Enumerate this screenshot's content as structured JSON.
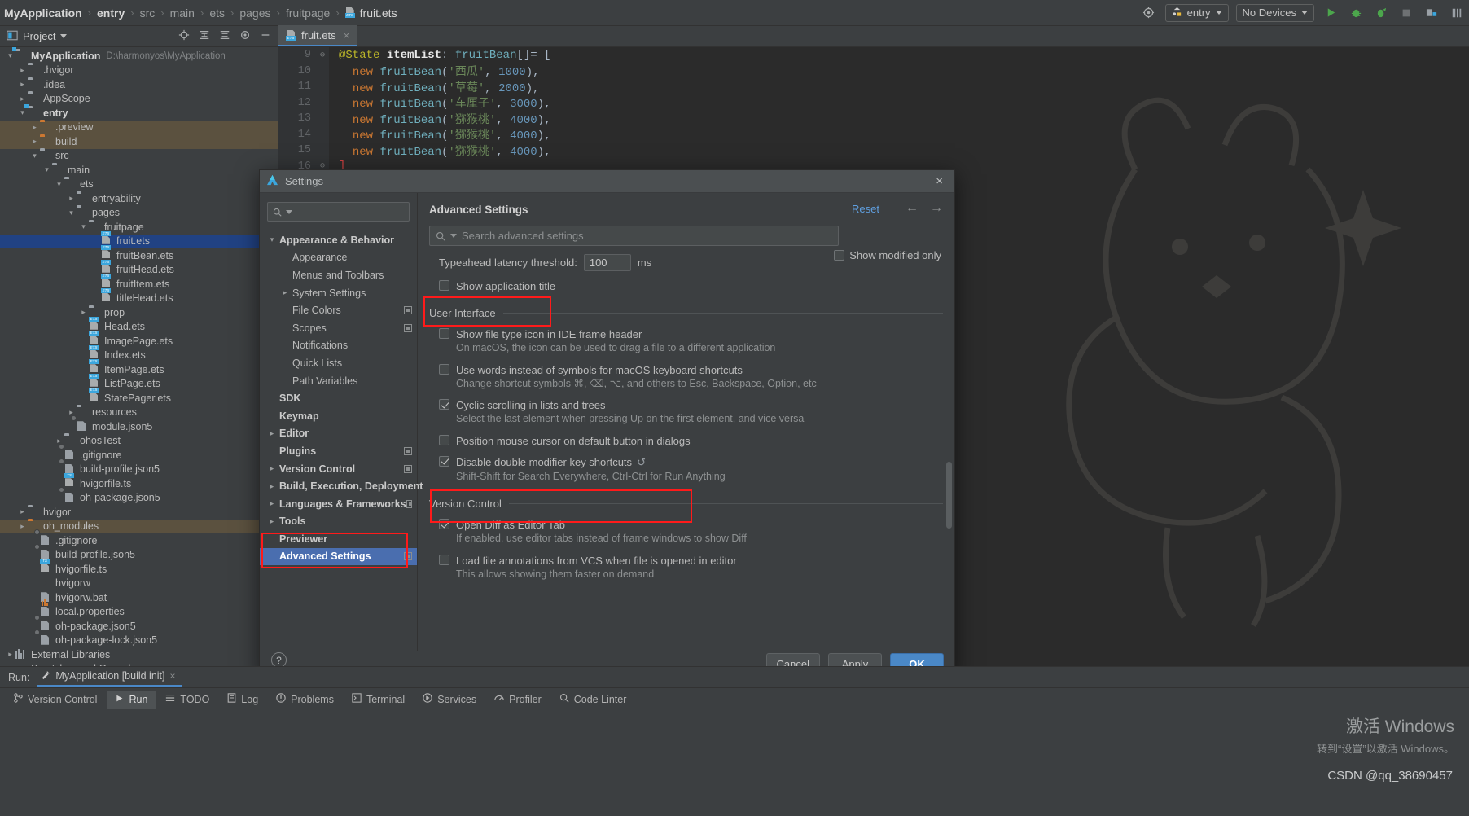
{
  "breadcrumb": {
    "items": [
      "MyApplication",
      "entry",
      "src",
      "main",
      "ets",
      "pages",
      "fruitpage",
      "fruit.ets"
    ],
    "separator": "›"
  },
  "toolbar": {
    "target_label": "entry",
    "device_label": "No Devices",
    "icons": [
      "settings-gear-icon",
      "run-icon",
      "debug-icon",
      "attach-debugger-icon",
      "stop-icon",
      "device-manager-icon",
      "sdk-icon"
    ]
  },
  "tool_window": {
    "title": "Project",
    "actions": [
      "locate-icon",
      "expand-all-icon",
      "collapse-all-icon",
      "settings-gear-icon",
      "hide-icon"
    ]
  },
  "editor": {
    "tab_label": "fruit.ets",
    "tab_close": "×",
    "lines": [
      {
        "n": "9",
        "fold": "⊖",
        "html": "<span class=\"ann\">@State</span> <span class=\"var\">itemList</span><span class=\"pun\">:</span> <span class=\"typ\">fruitBean</span><span class=\"pun\">[]= [</span>"
      },
      {
        "n": "10",
        "fold": "",
        "html": "  <span class=\"kw\">new</span> <span class=\"typ\">fruitBean</span><span class=\"pun\">(</span><span class=\"str\">'西瓜'</span><span class=\"pun\">, </span><span class=\"num\">1000</span><span class=\"pun\">),</span>"
      },
      {
        "n": "11",
        "fold": "",
        "html": "  <span class=\"kw\">new</span> <span class=\"typ\">fruitBean</span><span class=\"pun\">(</span><span class=\"str\">'草莓'</span><span class=\"pun\">, </span><span class=\"num\">2000</span><span class=\"pun\">),</span>"
      },
      {
        "n": "12",
        "fold": "",
        "html": "  <span class=\"kw\">new</span> <span class=\"typ\">fruitBean</span><span class=\"pun\">(</span><span class=\"str\">'车厘子'</span><span class=\"pun\">, </span><span class=\"num\">3000</span><span class=\"pun\">),</span>"
      },
      {
        "n": "13",
        "fold": "",
        "html": "  <span class=\"kw\">new</span> <span class=\"typ\">fruitBean</span><span class=\"pun\">(</span><span class=\"str\">'猕猴桃'</span><span class=\"pun\">, </span><span class=\"num\">4000</span><span class=\"pun\">),</span>"
      },
      {
        "n": "14",
        "fold": "",
        "html": "  <span class=\"kw\">new</span> <span class=\"typ\">fruitBean</span><span class=\"pun\">(</span><span class=\"str\">'猕猴桃'</span><span class=\"pun\">, </span><span class=\"num\">4000</span><span class=\"pun\">),</span>"
      },
      {
        "n": "15",
        "fold": "",
        "html": "  <span class=\"kw\">new</span> <span class=\"typ\">fruitBean</span><span class=\"pun\">(</span><span class=\"str\">'猕猴桃'</span><span class=\"pun\">, </span><span class=\"num\">4000</span><span class=\"pun\">),</span>"
      },
      {
        "n": "16",
        "fold": "⊖",
        "html": "<span class=\"red\">]</span>"
      }
    ]
  },
  "project_tree": [
    {
      "indent": 0,
      "arrow": "down",
      "icon": "folder-module",
      "label": "MyApplication",
      "bold": true,
      "path": "D:\\harmonyos\\MyApplication"
    },
    {
      "indent": 1,
      "arrow": "right",
      "icon": "folder",
      "label": ".hvigor"
    },
    {
      "indent": 1,
      "arrow": "right",
      "icon": "folder",
      "label": ".idea"
    },
    {
      "indent": 1,
      "arrow": "right",
      "icon": "folder",
      "label": "AppScope"
    },
    {
      "indent": 1,
      "arrow": "down",
      "icon": "folder-module",
      "label": "entry",
      "bold": true
    },
    {
      "indent": 2,
      "arrow": "right",
      "icon": "folder-orange",
      "label": ".preview",
      "highlight": "brown"
    },
    {
      "indent": 2,
      "arrow": "right",
      "icon": "folder-orange",
      "label": "build",
      "highlight": "brown"
    },
    {
      "indent": 2,
      "arrow": "down",
      "icon": "folder",
      "label": "src"
    },
    {
      "indent": 3,
      "arrow": "down",
      "icon": "folder",
      "label": "main"
    },
    {
      "indent": 4,
      "arrow": "down",
      "icon": "folder",
      "label": "ets"
    },
    {
      "indent": 5,
      "arrow": "right",
      "icon": "folder",
      "label": "entryability"
    },
    {
      "indent": 5,
      "arrow": "down",
      "icon": "folder",
      "label": "pages"
    },
    {
      "indent": 6,
      "arrow": "down",
      "icon": "folder",
      "label": "fruitpage"
    },
    {
      "indent": 7,
      "arrow": "none",
      "icon": "ets",
      "label": "fruit.ets",
      "highlight": "blue"
    },
    {
      "indent": 7,
      "arrow": "none",
      "icon": "ets",
      "label": "fruitBean.ets"
    },
    {
      "indent": 7,
      "arrow": "none",
      "icon": "ets",
      "label": "fruitHead.ets"
    },
    {
      "indent": 7,
      "arrow": "none",
      "icon": "ets",
      "label": "fruitItem.ets"
    },
    {
      "indent": 7,
      "arrow": "none",
      "icon": "ets",
      "label": "titleHead.ets"
    },
    {
      "indent": 6,
      "arrow": "right",
      "icon": "folder",
      "label": "prop"
    },
    {
      "indent": 6,
      "arrow": "none",
      "icon": "ets",
      "label": "Head.ets"
    },
    {
      "indent": 6,
      "arrow": "none",
      "icon": "ets",
      "label": "ImagePage.ets"
    },
    {
      "indent": 6,
      "arrow": "none",
      "icon": "ets",
      "label": "Index.ets"
    },
    {
      "indent": 6,
      "arrow": "none",
      "icon": "ets",
      "label": "ItemPage.ets"
    },
    {
      "indent": 6,
      "arrow": "none",
      "icon": "ets",
      "label": "ListPage.ets"
    },
    {
      "indent": 6,
      "arrow": "none",
      "icon": "ets",
      "label": "StatePager.ets"
    },
    {
      "indent": 5,
      "arrow": "right",
      "icon": "folder",
      "label": "resources"
    },
    {
      "indent": 5,
      "arrow": "none",
      "icon": "json5",
      "label": "module.json5"
    },
    {
      "indent": 4,
      "arrow": "right",
      "icon": "folder",
      "label": "ohosTest"
    },
    {
      "indent": 4,
      "arrow": "none",
      "icon": "gitignore",
      "label": ".gitignore"
    },
    {
      "indent": 4,
      "arrow": "none",
      "icon": "json5",
      "label": "build-profile.json5"
    },
    {
      "indent": 4,
      "arrow": "none",
      "icon": "ts",
      "label": "hvigorfile.ts"
    },
    {
      "indent": 4,
      "arrow": "none",
      "icon": "json5",
      "label": "oh-package.json5"
    },
    {
      "indent": 1,
      "arrow": "right",
      "icon": "folder",
      "label": "hvigor"
    },
    {
      "indent": 1,
      "arrow": "right",
      "icon": "folder-orange",
      "label": "oh_modules",
      "highlight": "brown"
    },
    {
      "indent": 2,
      "arrow": "none",
      "icon": "gitignore",
      "label": ".gitignore"
    },
    {
      "indent": 2,
      "arrow": "none",
      "icon": "json5",
      "label": "build-profile.json5"
    },
    {
      "indent": 2,
      "arrow": "none",
      "icon": "ts",
      "label": "hvigorfile.ts"
    },
    {
      "indent": 2,
      "arrow": "none",
      "icon": "run",
      "label": "hvigorw"
    },
    {
      "indent": 2,
      "arrow": "none",
      "icon": "generic",
      "label": "hvigorw.bat"
    },
    {
      "indent": 2,
      "arrow": "none",
      "icon": "properties",
      "label": "local.properties"
    },
    {
      "indent": 2,
      "arrow": "none",
      "icon": "json5",
      "label": "oh-package.json5"
    },
    {
      "indent": 2,
      "arrow": "none",
      "icon": "json5",
      "label": "oh-package-lock.json5"
    },
    {
      "indent": 0,
      "arrow": "right",
      "icon": "library",
      "label": "External Libraries"
    },
    {
      "indent": 0,
      "arrow": "none",
      "icon": "scratch",
      "label": "Scratches and Consoles"
    }
  ],
  "settings_dialog": {
    "title": "Settings",
    "close_label": "×",
    "search_placeholder": "",
    "nav": [
      {
        "arrow": "down",
        "label": "Appearance & Behavior",
        "bold": true,
        "indent": 0
      },
      {
        "arrow": "",
        "label": "Appearance",
        "indent": 1
      },
      {
        "arrow": "",
        "label": "Menus and Toolbars",
        "indent": 1
      },
      {
        "arrow": "right",
        "label": "System Settings",
        "indent": 1
      },
      {
        "arrow": "",
        "label": "File Colors",
        "indent": 1,
        "badge": true
      },
      {
        "arrow": "",
        "label": "Scopes",
        "indent": 1,
        "badge": true
      },
      {
        "arrow": "",
        "label": "Notifications",
        "indent": 1
      },
      {
        "arrow": "",
        "label": "Quick Lists",
        "indent": 1
      },
      {
        "arrow": "",
        "label": "Path Variables",
        "indent": 1
      },
      {
        "arrow": "",
        "label": "SDK",
        "bold": true,
        "indent": 0
      },
      {
        "arrow": "",
        "label": "Keymap",
        "bold": true,
        "indent": 0
      },
      {
        "arrow": "right",
        "label": "Editor",
        "bold": true,
        "indent": 0
      },
      {
        "arrow": "",
        "label": "Plugins",
        "bold": true,
        "indent": 0,
        "badge": true
      },
      {
        "arrow": "right",
        "label": "Version Control",
        "bold": true,
        "indent": 0,
        "badge": true
      },
      {
        "arrow": "right",
        "label": "Build, Execution, Deployment",
        "bold": true,
        "indent": 0
      },
      {
        "arrow": "right",
        "label": "Languages & Frameworks",
        "bold": true,
        "indent": 0,
        "badge": true
      },
      {
        "arrow": "right",
        "label": "Tools",
        "bold": true,
        "indent": 0
      },
      {
        "arrow": "",
        "label": "Previewer",
        "bold": true,
        "indent": 0
      },
      {
        "arrow": "",
        "label": "Advanced Settings",
        "bold": true,
        "indent": 0,
        "selected": true,
        "badge": true
      }
    ],
    "panel": {
      "title": "Advanced Settings",
      "reset_label": "Reset",
      "back_arrow": "←",
      "forward_arrow": "→",
      "search_placeholder": "Search advanced settings",
      "show_modified_only": {
        "label": "Show modified only",
        "checked": false
      },
      "typeahead": {
        "label": "Typeahead latency threshold:",
        "value": "100",
        "unit": "ms"
      },
      "show_application_title": {
        "label": "Show application title",
        "checked": false
      },
      "groups": [
        {
          "name": "User Interface",
          "items": [
            {
              "label": "Show file type icon in IDE frame header",
              "checked": false,
              "desc": "On macOS, the icon can be used to drag a file to a different application"
            },
            {
              "label": "Use words instead of symbols for macOS keyboard shortcuts",
              "checked": false,
              "desc": "Change shortcut symbols ⌘, ⌫, ⌥, and others to Esc, Backspace, Option, etc"
            },
            {
              "label": "Cyclic scrolling in lists and trees",
              "checked": true,
              "desc": "Select the last element when pressing Up on the first element, and vice versa"
            },
            {
              "label": "Position mouse cursor on default button in dialogs",
              "checked": false,
              "desc": ""
            },
            {
              "label": "Disable double modifier key shortcuts",
              "checked": true,
              "revert": "↺",
              "desc": "Shift-Shift for Search Everywhere, Ctrl-Ctrl for Run Anything"
            }
          ]
        },
        {
          "name": "Version Control",
          "items": [
            {
              "label": "Open Diff as Editor Tab",
              "checked": true,
              "desc": "If enabled, use editor tabs instead of frame windows to show Diff"
            },
            {
              "label": "Load file annotations from VCS when file is opened in editor",
              "checked": false,
              "desc": "This allows showing them faster on demand"
            }
          ]
        }
      ],
      "help_label": "?"
    },
    "buttons": {
      "cancel": "Cancel",
      "apply": "Apply",
      "ok": "OK"
    }
  },
  "run_panel": {
    "label": "Run:",
    "tab": "MyApplication [build init]",
    "close": "×"
  },
  "status_bar": {
    "items": [
      {
        "label": "Version Control",
        "icon": "branch-icon",
        "active": false
      },
      {
        "label": "Run",
        "icon": "play-icon",
        "active": true
      },
      {
        "label": "TODO",
        "icon": "list-icon",
        "active": false
      },
      {
        "label": "Log",
        "icon": "log-icon",
        "active": false
      },
      {
        "label": "Problems",
        "icon": "warning-icon",
        "active": false
      },
      {
        "label": "Terminal",
        "icon": "terminal-icon",
        "active": false
      },
      {
        "label": "Services",
        "icon": "services-icon",
        "active": false
      },
      {
        "label": "Profiler",
        "icon": "profiler-icon",
        "active": false
      },
      {
        "label": "Code Linter",
        "icon": "linter-icon",
        "active": false
      }
    ]
  },
  "watermark": {
    "line1": "激活 Windows",
    "line2": "转到“设置”以激活 Windows。",
    "csdn": "CSDN @qq_38690457"
  },
  "colors": {
    "accent_blue": "#4a88c7",
    "selection_blue": "#214283",
    "nav_selection": "#4a6eaf",
    "annotation_red": "#ff1a1a",
    "folder_orange": "#cc7832",
    "bg": "#3c3f41",
    "editor_bg": "#2b2b2b"
  }
}
